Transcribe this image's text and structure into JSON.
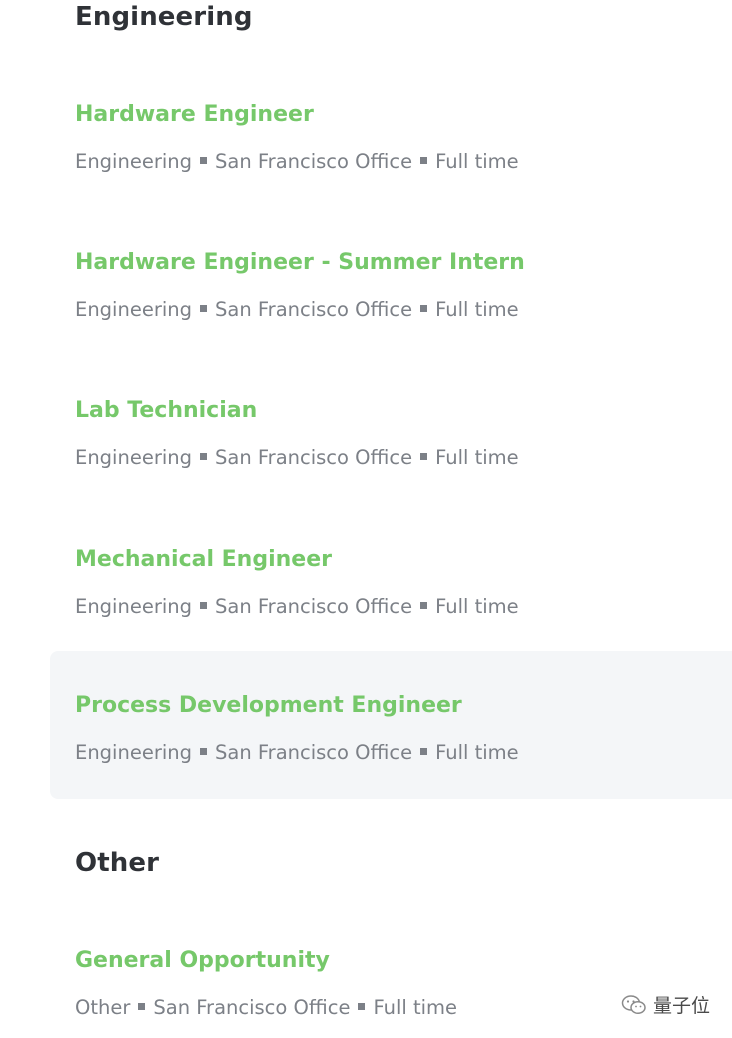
{
  "sections": [
    {
      "title": "Engineering",
      "postings": [
        {
          "title": "Hardware Engineer",
          "team": "Engineering",
          "location": "San Francisco Office",
          "commitment": "Full time"
        },
        {
          "title": "Hardware Engineer - Summer Intern",
          "team": "Engineering",
          "location": "San Francisco Office",
          "commitment": "Full time"
        },
        {
          "title": "Lab Technician",
          "team": "Engineering",
          "location": "San Francisco Office",
          "commitment": "Full time"
        },
        {
          "title": "Mechanical Engineer",
          "team": "Engineering",
          "location": "San Francisco Office",
          "commitment": "Full time"
        },
        {
          "title": "Process Development Engineer",
          "team": "Engineering",
          "location": "San Francisco Office",
          "commitment": "Full time"
        }
      ]
    },
    {
      "title": "Other",
      "postings": [
        {
          "title": "General Opportunity",
          "team": "Other",
          "location": "San Francisco Office",
          "commitment": "Full time"
        }
      ]
    }
  ],
  "watermark": {
    "text": "量子位",
    "icon": "wechat-icon"
  },
  "colors": {
    "posting_title": "#76c86a",
    "section_title": "#2f3237",
    "meta": "#7c8087",
    "hover_bg": "#f4f6f8"
  }
}
